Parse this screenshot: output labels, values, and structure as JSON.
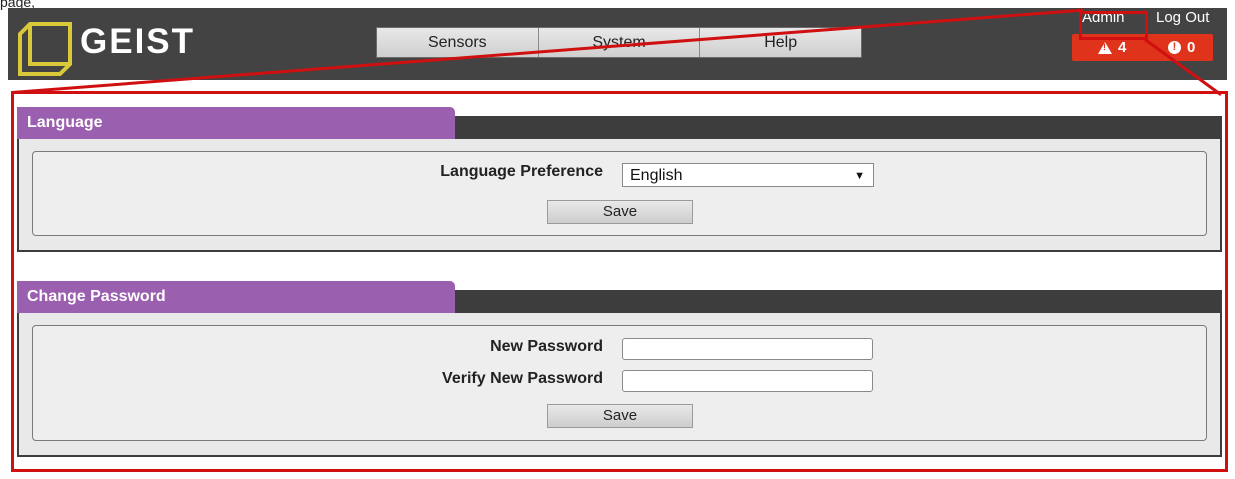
{
  "caption": "page,",
  "header": {
    "brand": "GEIST",
    "nav": [
      "Sensors",
      "System",
      "Help"
    ],
    "admin_label": "Admin",
    "logout_label": "Log Out",
    "alerts": {
      "warning_count": "4",
      "critical_count": "0"
    }
  },
  "language": {
    "title": "Language",
    "preference_label": "Language Preference",
    "selected": "English",
    "save_label": "Save"
  },
  "password": {
    "title": "Change Password",
    "new_label": "New Password",
    "verify_label": "Verify New Password",
    "save_label": "Save"
  },
  "colors": {
    "header_bg": "#434343",
    "section_tab": "#9a5fae",
    "alert_bg": "#e0331b",
    "highlight": "#d01010"
  }
}
